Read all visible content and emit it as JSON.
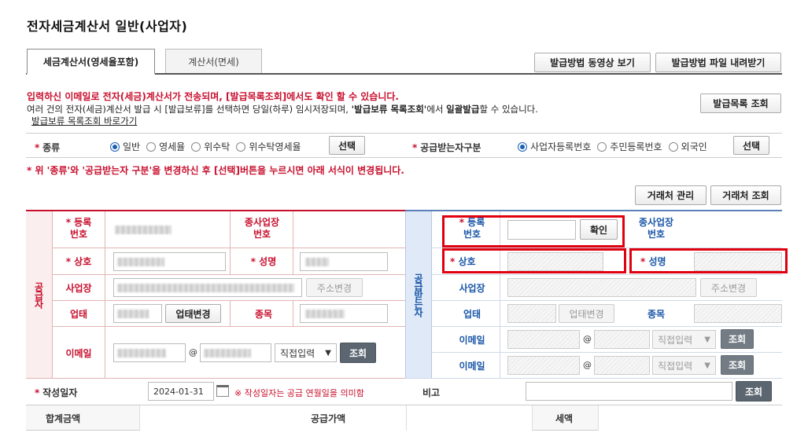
{
  "page": {
    "title": "전자세금계산서 일반(사업자)"
  },
  "tabs": [
    "세금계산서(영세율포함)",
    "계산서(면세)"
  ],
  "top_buttons": {
    "video": "발급방법 동영상 보기",
    "file": "발급방법 파일 내려받기",
    "issue_list": "발급목록 조회"
  },
  "notice": {
    "red": "입력하신 이메일로 전자(세금)계산서가 전송되며, [발급목록조회]에서도 확인 할 수 있습니다.",
    "info_a": "여러 건의 전자(세금)계산서 발급 시 [발급보류]를 선택하면 당일(하루) 임시저장되며, ",
    "info_b": "'발급보류 목록조회'",
    "info_c": "에서 ",
    "info_d": "일괄발급",
    "info_e": "할 수 있습니다.",
    "link": "발급보류 목록조회 바로가기"
  },
  "kind": {
    "label": "종류",
    "options": [
      "일반",
      "영세율",
      "위수탁",
      "위수탁영세율"
    ],
    "selected": "일반",
    "button": "선택"
  },
  "receiver_type": {
    "label": "공급받는자구분",
    "options": [
      "사업자등록번호",
      "주민등록번호",
      "외국인"
    ],
    "selected": "사업자등록번호",
    "button": "선택"
  },
  "warning": "* 위 '종류'와 '공급받는자 구분'을 변경하신 후 [선택]버튼을 누르시면 아래 서식이 변경됩니다.",
  "partner": {
    "manage": "거래처 관리",
    "search": "거래처 조회"
  },
  "supplier": {
    "side_label": "공급자",
    "reg_no": "등록\n번호",
    "sub_biz": "종사업장\n번호",
    "company": "상호",
    "name": "성명",
    "address": "사업장",
    "address_btn": "주소변경",
    "biz_type": "업태",
    "biz_type_btn": "업태변경",
    "item": "종목",
    "email": "이메일",
    "at": "@",
    "email_domain_select": "직접입력",
    "email_btn": "조회"
  },
  "receiver": {
    "side_label": "공급받는자",
    "reg_no": "등록\n번호",
    "confirm_btn": "확인",
    "sub_biz": "종사업장\n번호",
    "company": "상호",
    "name": "성명",
    "address": "사업장",
    "address_btn": "주소변경",
    "biz_type": "업태",
    "biz_type_btn": "업태변경",
    "item": "종목",
    "email1": "이메일",
    "email2": "이메일",
    "at": "@",
    "email_domain_select": "직접입력",
    "email_btn": "조회"
  },
  "date_row": {
    "label": "작성일자",
    "value": "2024-01-31",
    "note": "※ 작성일자는 공급 연월일을 의미함",
    "remark_label": "비고",
    "remark_btn": "조회"
  },
  "sum_row": {
    "total": "합계금액",
    "supply": "공급가액",
    "tax": "세액"
  },
  "colors": {
    "accent_red": "#c8102e",
    "highlight_red": "#e0000f",
    "receiver_bg": "#dfe9f7",
    "supplier_bg": "#fbeeee"
  }
}
